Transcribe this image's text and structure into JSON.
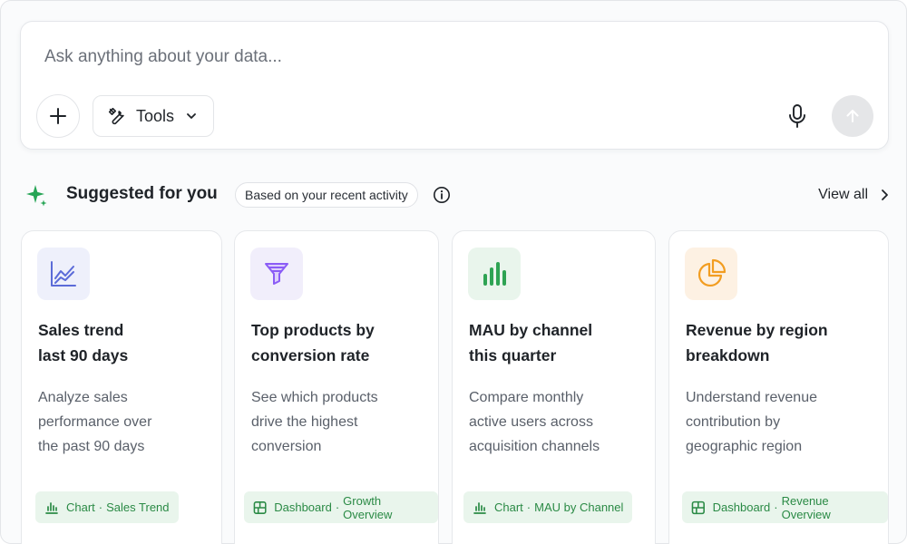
{
  "ask": {
    "placeholder": "Ask anything about your data...",
    "value": "",
    "tools_label": "Tools"
  },
  "suggested": {
    "title": "Suggested for you",
    "badge": "Based on your recent activity",
    "view_all": "View all"
  },
  "cards": [
    {
      "icon": "line-chart-icon",
      "icon_bg": "#eef0fb",
      "icon_color": "#5b6bd8",
      "title": [
        "Sales trend",
        "last 90 days"
      ],
      "description": [
        "Analyze sales",
        "performance over",
        "the past 90 days"
      ],
      "tag_icon": "bar-chart-icon",
      "tag_type": "Chart",
      "tag_sep": "·",
      "tag_name": "Sales Trend"
    },
    {
      "icon": "funnel-icon",
      "icon_bg": "#f1eefb",
      "icon_color": "#8b5cf6",
      "title": [
        "Top products by",
        "conversion rate"
      ],
      "description": [
        "See which products",
        "drive the highest",
        "conversion"
      ],
      "tag_icon": "dashboard-icon",
      "tag_type": "Dashboard",
      "tag_sep": "·",
      "tag_name": "Growth Overview"
    },
    {
      "icon": "bar-chart-icon",
      "icon_bg": "#e9f5ec",
      "icon_color": "#2ea353",
      "title": [
        "MAU by channel",
        "this quarter"
      ],
      "description": [
        "Compare monthly",
        "active users across",
        "acquisition channels"
      ],
      "tag_icon": "bar-chart-icon",
      "tag_type": "Chart",
      "tag_sep": "·",
      "tag_name": "MAU by Channel"
    },
    {
      "icon": "pie-chart-icon",
      "icon_bg": "#fdf1e3",
      "icon_color": "#f29d21",
      "title": [
        "Revenue by region",
        "breakdown"
      ],
      "description": [
        "Understand revenue",
        "contribution by",
        "geographic region"
      ],
      "tag_icon": "dashboard-icon",
      "tag_type": "Dashboard",
      "tag_sep": "·",
      "tag_name": "Revenue Overview"
    }
  ],
  "colors": {
    "accent_green": "#2a8a45",
    "spark_green": "#27a556"
  }
}
